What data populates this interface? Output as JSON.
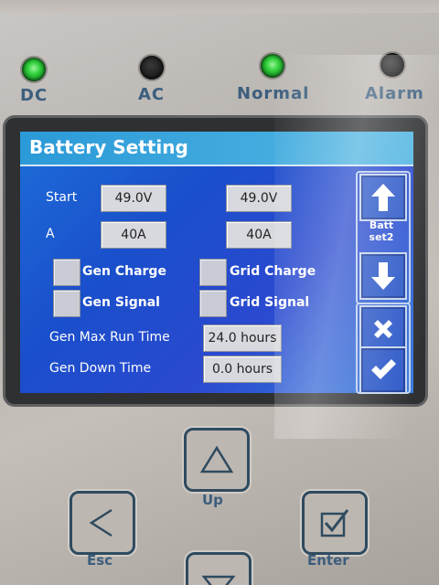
{
  "indicators": [
    {
      "label": "DC",
      "state": "on"
    },
    {
      "label": "AC",
      "state": "off"
    },
    {
      "label": "Normal",
      "state": "on"
    },
    {
      "label": "Alarm",
      "state": "off"
    }
  ],
  "screen": {
    "title": "Battery Setting",
    "rows": {
      "start": {
        "label": "Start",
        "value1": "49.0V",
        "value2": "49.0V"
      },
      "a": {
        "label": "A",
        "value1": "40A",
        "value2": "40A"
      }
    },
    "checkboxes": {
      "gen_charge": "Gen Charge",
      "grid_charge": "Grid Charge",
      "gen_signal": "Gen Signal",
      "grid_signal": "Grid Signal"
    },
    "gen_max_run_time": {
      "label": "Gen Max Run Time",
      "value": "24.0 hours"
    },
    "gen_down_time": {
      "label": "Gen Down Time",
      "value": "0.0 hours"
    },
    "side": {
      "page_label_line1": "Batt",
      "page_label_line2": "set2",
      "up_icon": "arrow-up-icon",
      "down_icon": "arrow-down-icon",
      "cancel_icon": "x-icon",
      "confirm_icon": "check-icon"
    }
  },
  "keys": {
    "up": "Up",
    "esc": "Esc",
    "enter": "Enter"
  },
  "colors": {
    "screen_blue": "#1a4fcb",
    "title_bar": "#2b9ad8",
    "label_blue": "#3c5e7e",
    "led_green": "#2fd03a"
  }
}
